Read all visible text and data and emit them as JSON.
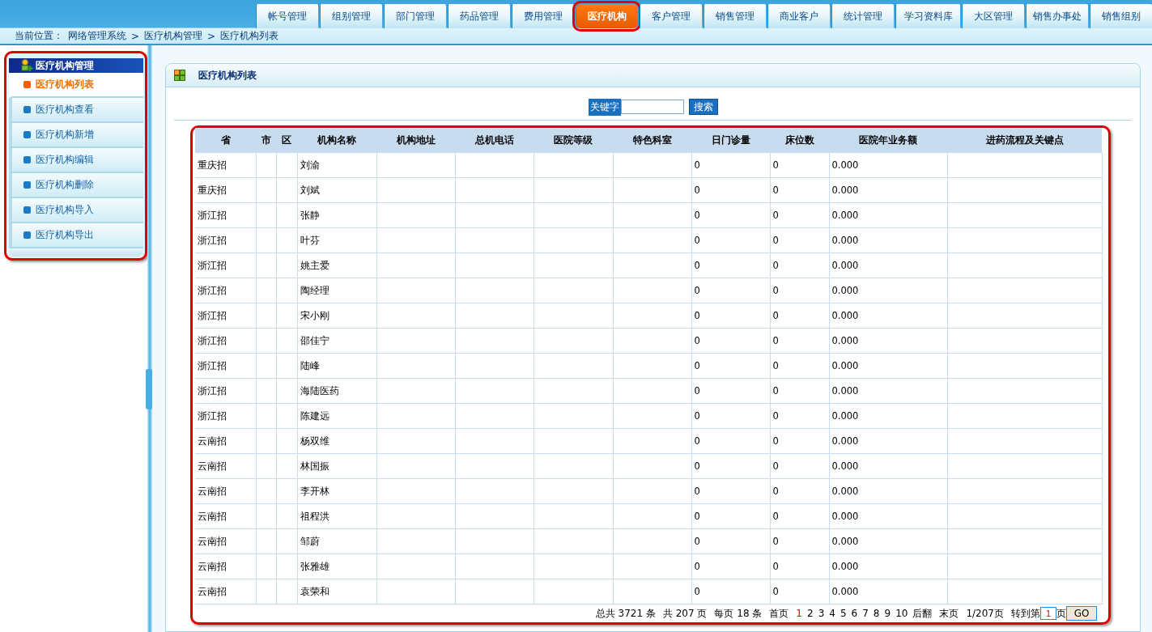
{
  "nav_tabs": [
    {
      "label": "帐号管理",
      "selected": false,
      "highlighted": false
    },
    {
      "label": "组别管理",
      "selected": false,
      "highlighted": false
    },
    {
      "label": "部门管理",
      "selected": false,
      "highlighted": false
    },
    {
      "label": "药品管理",
      "selected": false,
      "highlighted": false
    },
    {
      "label": "费用管理",
      "selected": false,
      "highlighted": false
    },
    {
      "label": "医疗机构",
      "selected": true,
      "highlighted": true
    },
    {
      "label": "客户管理",
      "selected": false,
      "highlighted": false
    },
    {
      "label": "销售管理",
      "selected": false,
      "highlighted": false
    },
    {
      "label": "商业客户",
      "selected": false,
      "highlighted": false
    },
    {
      "label": "统计管理",
      "selected": false,
      "highlighted": false
    },
    {
      "label": "学习资料库",
      "selected": false,
      "highlighted": false
    },
    {
      "label": "大区管理",
      "selected": false,
      "highlighted": false
    },
    {
      "label": "销售办事处",
      "selected": false,
      "highlighted": false
    },
    {
      "label": "销售组别",
      "selected": false,
      "highlighted": false
    }
  ],
  "breadcrumb": {
    "label": "当前位置：",
    "items": [
      "网络管理系统",
      "医疗机构管理",
      "医疗机构列表"
    ],
    "separator": ">"
  },
  "sidebar": {
    "title": "医疗机构管理",
    "highlighted": true,
    "items": [
      {
        "label": "医疗机构列表",
        "selected": true
      },
      {
        "label": "医疗机构查看",
        "selected": false
      },
      {
        "label": "医疗机构新增",
        "selected": false
      },
      {
        "label": "医疗机构编辑",
        "selected": false
      },
      {
        "label": "医疗机构删除",
        "selected": false
      },
      {
        "label": "医疗机构导入",
        "selected": false
      },
      {
        "label": "医疗机构导出",
        "selected": false
      }
    ]
  },
  "panel": {
    "title": "医疗机构列表",
    "search": {
      "label": "关键字",
      "button": "搜索"
    }
  },
  "table": {
    "highlighted": true,
    "columns": [
      "省",
      "市",
      "区",
      "机构名称",
      "机构地址",
      "总机电话",
      "医院等级",
      "特色科室",
      "日门诊量",
      "床位数",
      "医院年业务额",
      "进药流程及关键点"
    ],
    "rows": [
      {
        "province": "重庆招",
        "name": "刘渝",
        "outpatient": "0",
        "beds": "0",
        "revenue": "0.000"
      },
      {
        "province": "重庆招",
        "name": "刘斌",
        "outpatient": "0",
        "beds": "0",
        "revenue": "0.000"
      },
      {
        "province": "浙江招",
        "name": "张静",
        "outpatient": "0",
        "beds": "0",
        "revenue": "0.000"
      },
      {
        "province": "浙江招",
        "name": "叶芬",
        "outpatient": "0",
        "beds": "0",
        "revenue": "0.000"
      },
      {
        "province": "浙江招",
        "name": "姚主爱",
        "outpatient": "0",
        "beds": "0",
        "revenue": "0.000"
      },
      {
        "province": "浙江招",
        "name": "陶经理",
        "outpatient": "0",
        "beds": "0",
        "revenue": "0.000"
      },
      {
        "province": "浙江招",
        "name": "宋小刚",
        "outpatient": "0",
        "beds": "0",
        "revenue": "0.000"
      },
      {
        "province": "浙江招",
        "name": "邵佳宁",
        "outpatient": "0",
        "beds": "0",
        "revenue": "0.000"
      },
      {
        "province": "浙江招",
        "name": "陆峰",
        "outpatient": "0",
        "beds": "0",
        "revenue": "0.000"
      },
      {
        "province": "浙江招",
        "name": "海陆医药",
        "outpatient": "0",
        "beds": "0",
        "revenue": "0.000"
      },
      {
        "province": "浙江招",
        "name": "陈建远",
        "outpatient": "0",
        "beds": "0",
        "revenue": "0.000"
      },
      {
        "province": "云南招",
        "name": "杨双维",
        "outpatient": "0",
        "beds": "0",
        "revenue": "0.000"
      },
      {
        "province": "云南招",
        "name": "林国振",
        "outpatient": "0",
        "beds": "0",
        "revenue": "0.000"
      },
      {
        "province": "云南招",
        "name": "李开林",
        "outpatient": "0",
        "beds": "0",
        "revenue": "0.000"
      },
      {
        "province": "云南招",
        "name": "祖程洪",
        "outpatient": "0",
        "beds": "0",
        "revenue": "0.000"
      },
      {
        "province": "云南招",
        "name": "邹蔚",
        "outpatient": "0",
        "beds": "0",
        "revenue": "0.000"
      },
      {
        "province": "云南招",
        "name": "张雅雄",
        "outpatient": "0",
        "beds": "0",
        "revenue": "0.000"
      },
      {
        "province": "云南招",
        "name": "袁荣和",
        "outpatient": "0",
        "beds": "0",
        "revenue": "0.000"
      }
    ]
  },
  "pagination": {
    "total": "总共 3721 条",
    "pages": "共 207 页",
    "per_page": "每页 18 条",
    "first": "首页",
    "page_links": [
      {
        "label": "1",
        "selected": true
      },
      {
        "label": "2",
        "selected": false
      },
      {
        "label": "3",
        "selected": false
      },
      {
        "label": "4",
        "selected": false
      },
      {
        "label": "5",
        "selected": false
      },
      {
        "label": "6",
        "selected": false
      },
      {
        "label": "7",
        "selected": false
      },
      {
        "label": "8",
        "selected": false
      },
      {
        "label": "9",
        "selected": false
      },
      {
        "label": "10",
        "selected": false
      }
    ],
    "next": "后翻",
    "last": "末页",
    "position": "1/207页",
    "goto_label": "转到第",
    "goto_value": "1",
    "goto_suffix": "页",
    "go_button": "GO"
  }
}
